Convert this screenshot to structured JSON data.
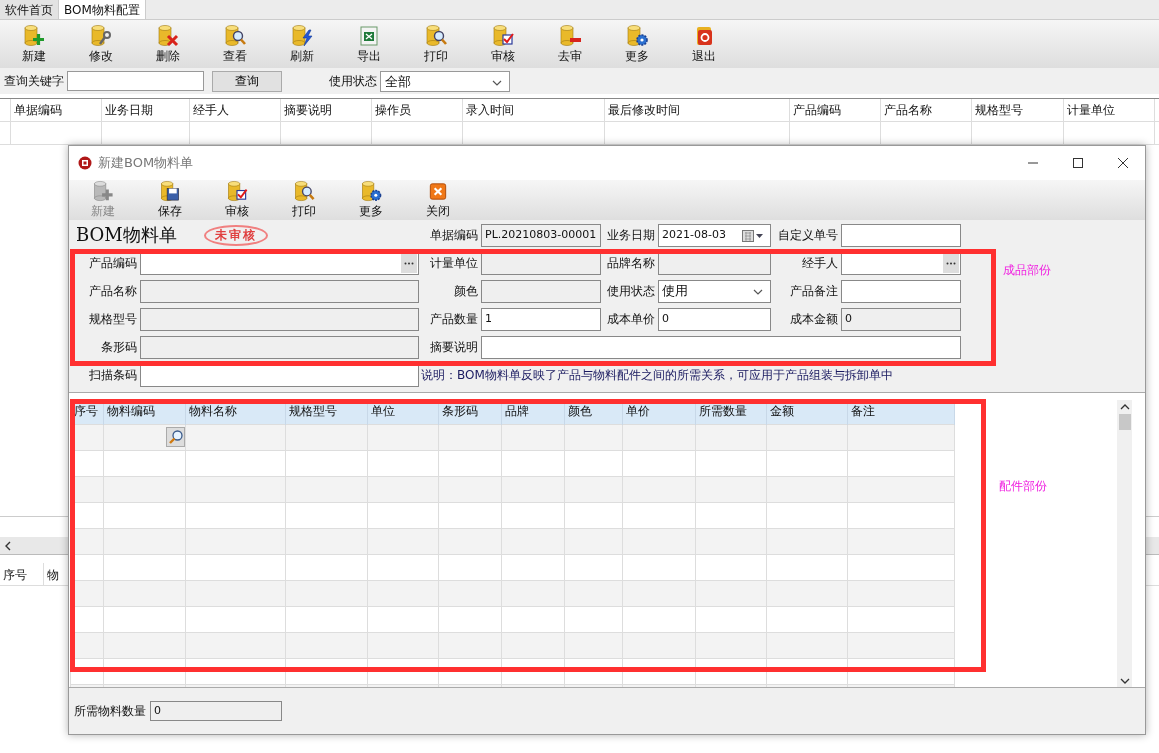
{
  "main_tabs": [
    {
      "label": "软件首页",
      "selected": false
    },
    {
      "label": "BOM物料配置",
      "selected": true
    }
  ],
  "main_toolbar": [
    {
      "label": "新建",
      "kind": "add"
    },
    {
      "label": "修改",
      "kind": "edit"
    },
    {
      "label": "删除",
      "kind": "delete"
    },
    {
      "label": "查看",
      "kind": "view"
    },
    {
      "label": "刷新",
      "kind": "refresh"
    },
    {
      "label": "导出",
      "kind": "export"
    },
    {
      "label": "打印",
      "kind": "print"
    },
    {
      "label": "审核",
      "kind": "approve"
    },
    {
      "label": "去审",
      "kind": "unapprove"
    },
    {
      "label": "更多",
      "kind": "more"
    },
    {
      "label": "退出",
      "kind": "exit"
    }
  ],
  "search": {
    "label": "查询关键字",
    "button": "查询",
    "status_label": "使用状态",
    "status_value": "全部"
  },
  "list_table": {
    "columns": [
      "单据编码",
      "业务日期",
      "经手人",
      "摘要说明",
      "操作员",
      "录入时间",
      "最后修改时间",
      "产品编码",
      "产品名称",
      "规格型号",
      "计量单位"
    ]
  },
  "detail_table": {
    "columns": [
      "序号",
      "物"
    ]
  },
  "dialog": {
    "title": "新建BOM物料单",
    "toolbar": [
      {
        "label": "新建",
        "kind": "add",
        "disabled": true
      },
      {
        "label": "保存",
        "kind": "save",
        "disabled": false
      },
      {
        "label": "审核",
        "kind": "approve",
        "disabled": false
      },
      {
        "label": "打印",
        "kind": "print",
        "disabled": false
      },
      {
        "label": "更多",
        "kind": "more",
        "disabled": false
      },
      {
        "label": "关闭",
        "kind": "close",
        "disabled": false
      }
    ],
    "form_title": "BOM物料单",
    "stamp": "未审核",
    "header_fields": [
      {
        "label": "单据编码",
        "kind": "readonly",
        "value": "PL.20210803-00001"
      },
      {
        "label": "业务日期",
        "kind": "date",
        "value": "2021-08-03"
      },
      {
        "label": "自定义单号",
        "kind": "text"
      }
    ],
    "fields": [
      [
        {
          "label": "产品编码",
          "kind": "lookup"
        },
        {
          "label": "计量单位",
          "kind": "readonly"
        },
        {
          "label": "品牌名称",
          "kind": "readonly"
        },
        {
          "label": "经手人",
          "kind": "lookup"
        }
      ],
      [
        {
          "label": "产品名称",
          "kind": "readonly"
        },
        {
          "label": "颜色",
          "kind": "readonly"
        },
        {
          "label": "使用状态",
          "kind": "select",
          "value": "使用"
        },
        {
          "label": "产品备注",
          "kind": "text"
        }
      ],
      [
        {
          "label": "规格型号",
          "kind": "readonly"
        },
        {
          "label": "产品数量",
          "kind": "text",
          "value": "1"
        },
        {
          "label": "成本单价",
          "kind": "text",
          "value": "0"
        },
        {
          "label": "成本金额",
          "kind": "readonly",
          "value": "0"
        }
      ],
      [
        {
          "label": "条形码",
          "kind": "readonly"
        },
        {
          "label": "摘要说明",
          "kind": "wide_text"
        }
      ],
      [
        {
          "label": "扫描条码",
          "kind": "text"
        }
      ]
    ],
    "note": "说明：BOM物料单反映了产品与物料配件之间的所需关系，可应用于产品组装与拆卸单中",
    "grid": {
      "columns": [
        "序号",
        "物料编码",
        "物料名称",
        "规格型号",
        "单位",
        "条形码",
        "品牌",
        "颜色",
        "单价",
        "所需数量",
        "金额",
        "备注"
      ]
    },
    "footer": {
      "label": "所需物料数量",
      "value": "0"
    },
    "annotations": [
      {
        "text": "成品部份"
      },
      {
        "text": "配件部份"
      }
    ]
  }
}
